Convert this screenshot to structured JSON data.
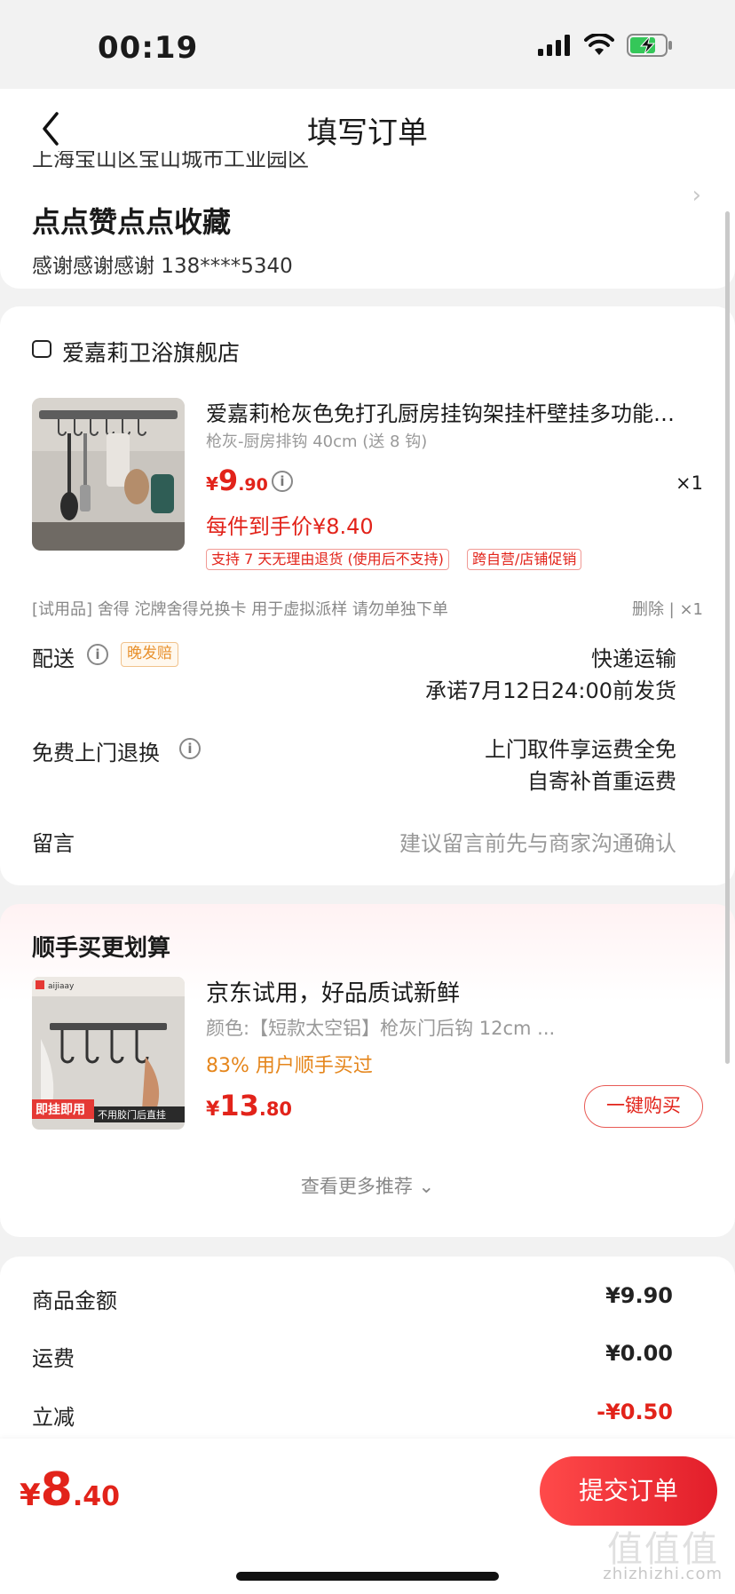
{
  "status_bar": {
    "time": "00:19"
  },
  "header": {
    "title": "填写订单"
  },
  "address": {
    "partial_line": "上海宝山区宝山城市工业园区",
    "name": "点点赞点点收藏",
    "contact": "感谢感谢感谢  138****5340"
  },
  "store": {
    "name": "爱嘉莉卫浴旗舰店"
  },
  "product": {
    "title": "爱嘉莉枪灰色免打孔厨房挂钩架挂杆壁挂多功能…",
    "spec": "枪灰-厨房排钩 40cm (送 8 钩)",
    "price_symbol": "¥",
    "price_int": "9",
    "price_dec": ".90",
    "quantity": "×1",
    "final_price": "每件到手价¥8.40",
    "tags": [
      "支持 7 天无理由退货 (使用后不支持)",
      "跨自营/店铺促销"
    ]
  },
  "trial": {
    "text": "[试用品] 舍得 沱牌舍得兑换卡 用于虚拟派样 请勿单独下单",
    "action": "删除 | ×1"
  },
  "delivery": {
    "label": "配送",
    "badge": "晚发赔",
    "method": "快递运输",
    "promise": "承诺7月12日24:00前发货"
  },
  "returns": {
    "label": "免费上门退换",
    "line1": "上门取件享运费全免",
    "line2": "自寄补首重运费"
  },
  "message": {
    "label": "留言",
    "placeholder": "建议留言前先与商家沟通确认"
  },
  "recommend": {
    "title": "顺手买更划算",
    "item_name": "京东试用，好品质试新鲜",
    "item_spec": "颜色:【短款太空铝】枪灰门后钩 12cm   ...",
    "bought": "83% 用户顺手买过",
    "price_symbol": "¥",
    "price_int": "13",
    "price_dec": ".80",
    "buy_button": "一键购买",
    "more": "查看更多推荐 ⌄",
    "image_text_1": "即挂即用",
    "image_text_2": "不用胶门后直挂",
    "image_brand": "aijiaay"
  },
  "summary": {
    "rows": [
      {
        "label": "商品金额",
        "value": "¥9.90"
      },
      {
        "label": "运费",
        "value": "¥0.00"
      },
      {
        "label": "立减",
        "value": "-¥0.50"
      }
    ]
  },
  "footer": {
    "total_symbol": "¥",
    "total_int": "8",
    "total_dec": ".40",
    "submit": "提交订单",
    "watermark_logo": "值值值",
    "watermark": "zhizhizhi.com"
  },
  "colors": {
    "accent": "#e2231a",
    "orange": "#e5861c",
    "background": "#f2f2f2"
  }
}
